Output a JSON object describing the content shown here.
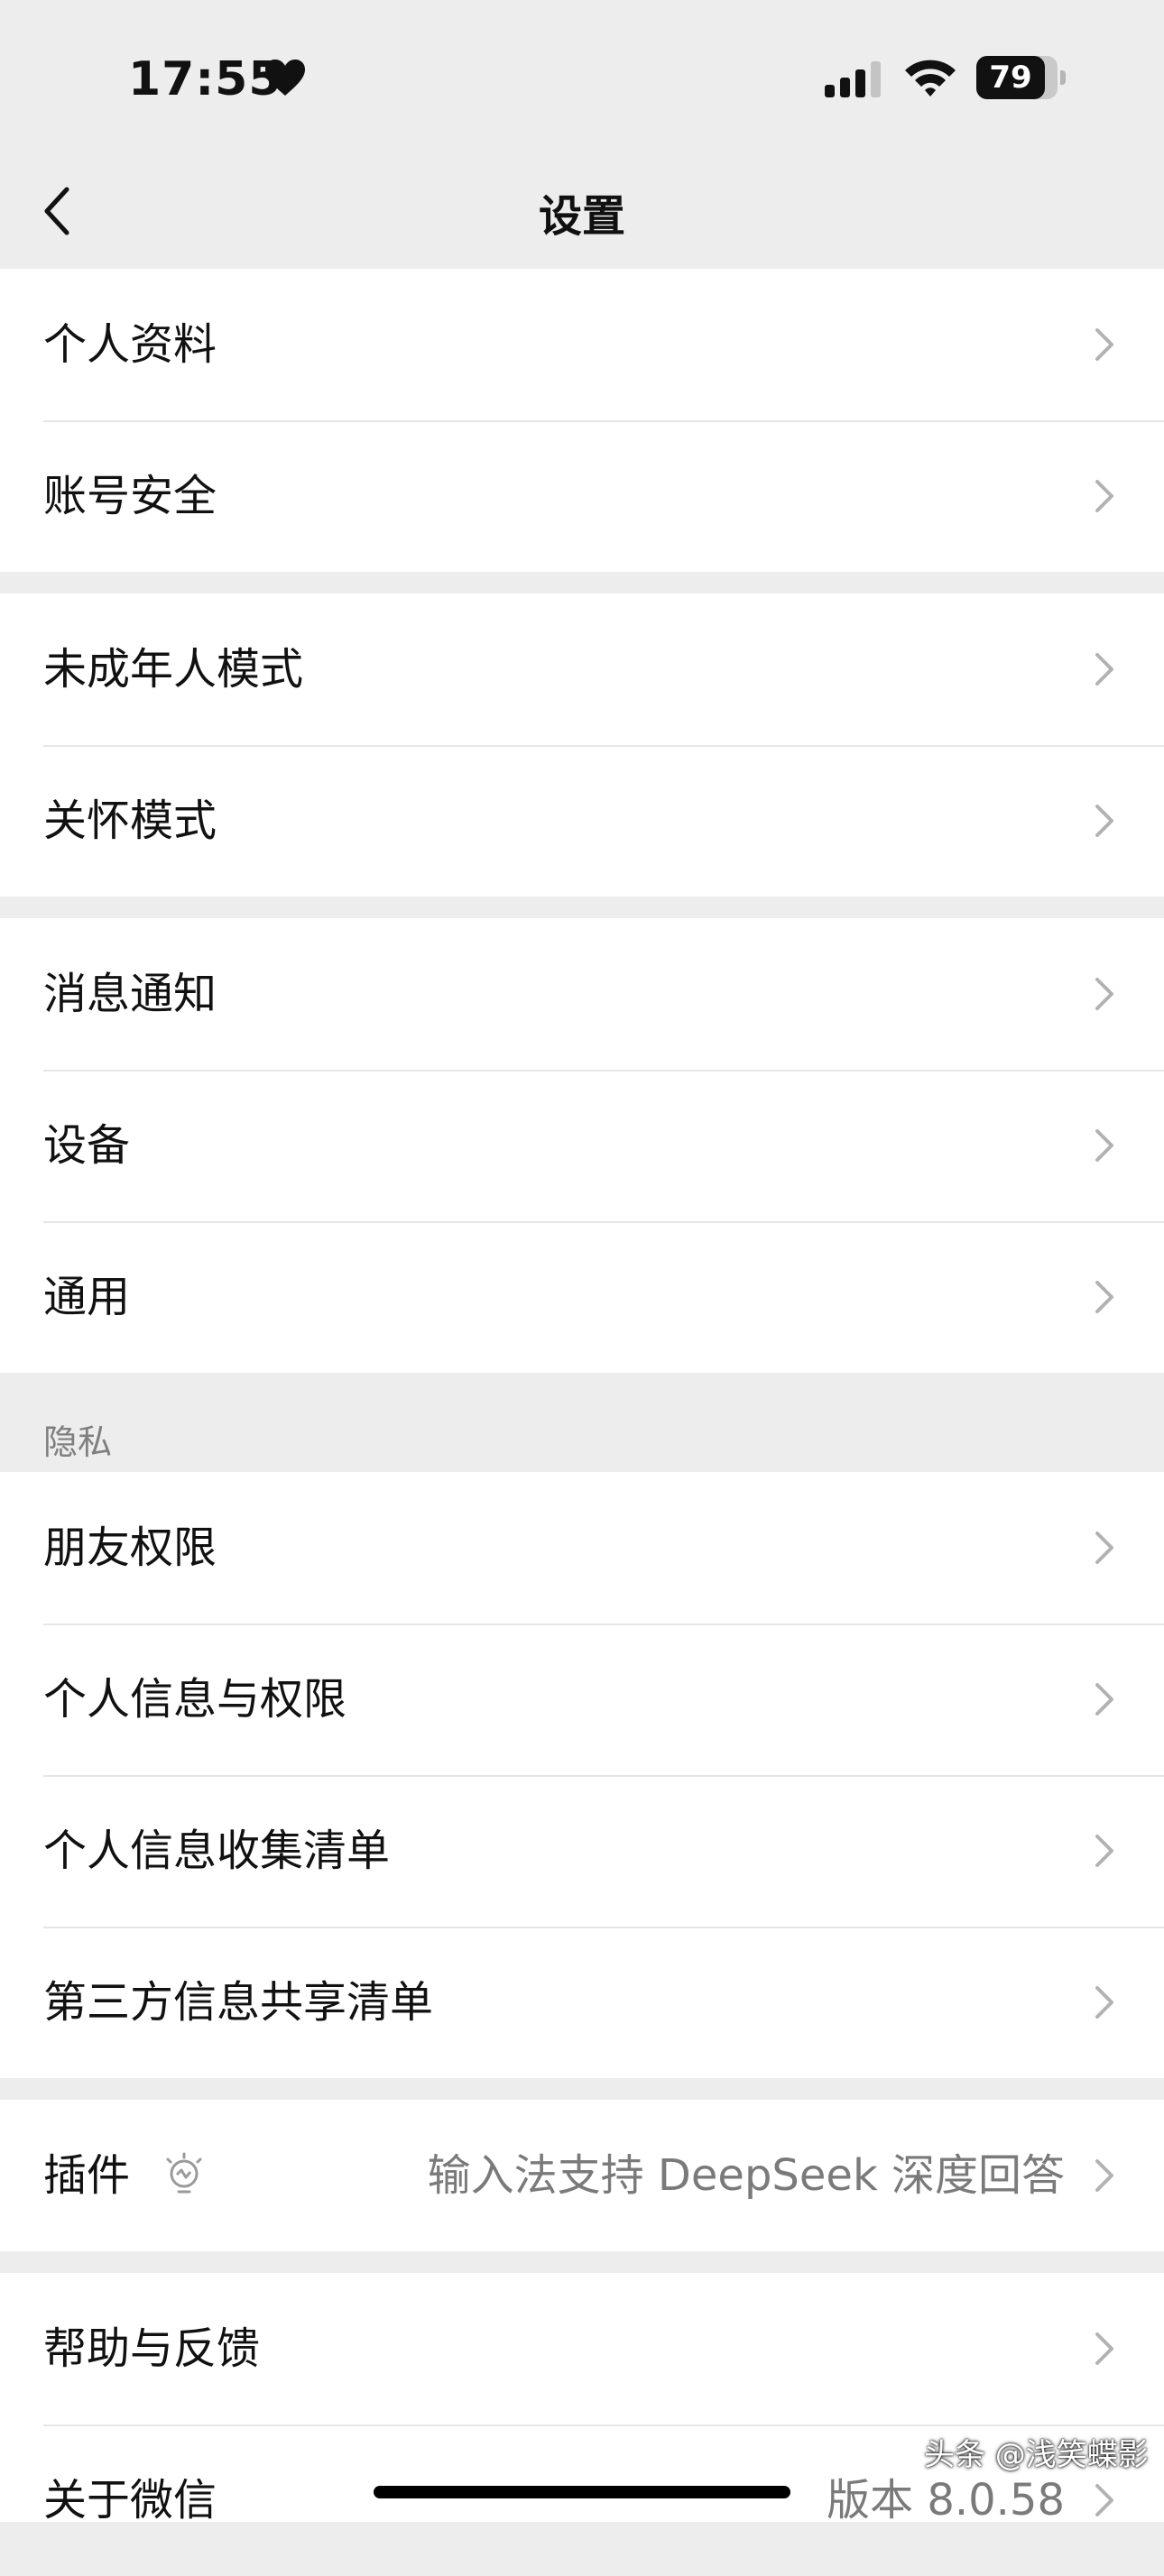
{
  "status_bar": {
    "time": "17:55",
    "battery": "79"
  },
  "nav": {
    "title": "设置"
  },
  "groups": [
    {
      "items": [
        {
          "label": "个人资料"
        },
        {
          "label": "账号安全"
        }
      ]
    },
    {
      "items": [
        {
          "label": "未成年人模式"
        },
        {
          "label": "关怀模式"
        }
      ]
    },
    {
      "items": [
        {
          "label": "消息通知"
        },
        {
          "label": "设备"
        },
        {
          "label": "通用"
        }
      ]
    },
    {
      "header": "隐私",
      "items": [
        {
          "label": "朋友权限"
        },
        {
          "label": "个人信息与权限"
        },
        {
          "label": "个人信息收集清单"
        },
        {
          "label": "第三方信息共享清单"
        }
      ]
    },
    {
      "items": [
        {
          "label": "插件",
          "value": "输入法支持 DeepSeek 深度回答"
        }
      ]
    },
    {
      "items": [
        {
          "label": "帮助与反馈"
        },
        {
          "label": "关于微信",
          "value": "版本 8.0.58"
        }
      ]
    }
  ],
  "watermark": "头条 @浅笑蝶影"
}
